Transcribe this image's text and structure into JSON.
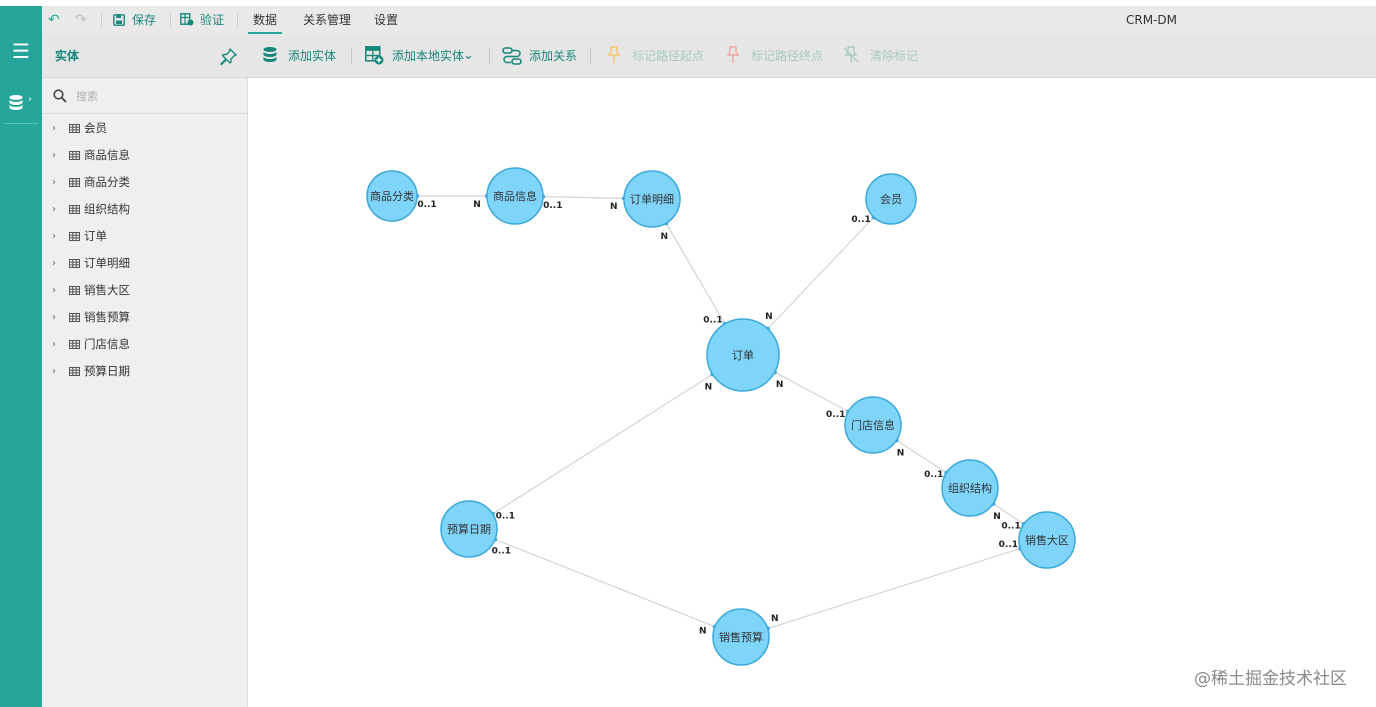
{
  "menubar": {
    "save": "保存",
    "validate": "验证",
    "tabs": [
      "数据",
      "关系管理",
      "设置"
    ],
    "doc_title": "CRM-DM"
  },
  "panel": {
    "title": "实体"
  },
  "toolbar": {
    "add_entity": "添加实体",
    "add_local_entity": "添加本地实体",
    "add_relation": "添加关系",
    "mark_start": "标记路径起点",
    "mark_end": "标记路径终点",
    "clear_marks": "清除标记"
  },
  "search": {
    "placeholder": "搜索"
  },
  "tree": [
    "会员",
    "商品信息",
    "商品分类",
    "组织结构",
    "订单",
    "订单明细",
    "销售大区",
    "销售预算",
    "门店信息",
    "预算日期"
  ],
  "diagram": {
    "nodes": [
      {
        "id": "spfl",
        "label": "商品分类"
      },
      {
        "id": "spxx",
        "label": "商品信息"
      },
      {
        "id": "ddmx",
        "label": "订单明细"
      },
      {
        "id": "hy",
        "label": "会员"
      },
      {
        "id": "dd",
        "label": "订单"
      },
      {
        "id": "mdxx",
        "label": "门店信息"
      },
      {
        "id": "zzjg",
        "label": "组织结构"
      },
      {
        "id": "xsdq",
        "label": "销售大区"
      },
      {
        "id": "ysrq",
        "label": "预算日期"
      },
      {
        "id": "xsys",
        "label": "销售预算"
      }
    ],
    "edges": [
      {
        "from": "spfl",
        "to": "spxx",
        "from_card": "0..1",
        "to_card": "N"
      },
      {
        "from": "spxx",
        "to": "ddmx",
        "from_card": "0..1",
        "to_card": "N"
      },
      {
        "from": "ddmx",
        "to": "dd",
        "from_card": "N",
        "to_card": "0..1"
      },
      {
        "from": "hy",
        "to": "dd",
        "from_card": "0..1",
        "to_card": "N"
      },
      {
        "from": "dd",
        "to": "mdxx",
        "from_card": "N",
        "to_card": "0..1"
      },
      {
        "from": "mdxx",
        "to": "zzjg",
        "from_card": "N",
        "to_card": "0..1"
      },
      {
        "from": "zzjg",
        "to": "xsdq",
        "from_card": "N",
        "to_card": "0..1"
      },
      {
        "from": "ysrq",
        "to": "dd",
        "from_card": "0..1",
        "to_card": "N"
      },
      {
        "from": "ysrq",
        "to": "xsys",
        "from_card": "0..1",
        "to_card": "N"
      },
      {
        "from": "xsdq",
        "to": "xsys",
        "from_card": "0..1",
        "to_card": "N"
      }
    ]
  },
  "watermark": "@稀土掘金技术社区",
  "colors": {
    "accent": "#26a69a",
    "node_fill": "#7fd4fa",
    "node_stroke": "#3aa9db",
    "edge": "#d4d4d4"
  }
}
